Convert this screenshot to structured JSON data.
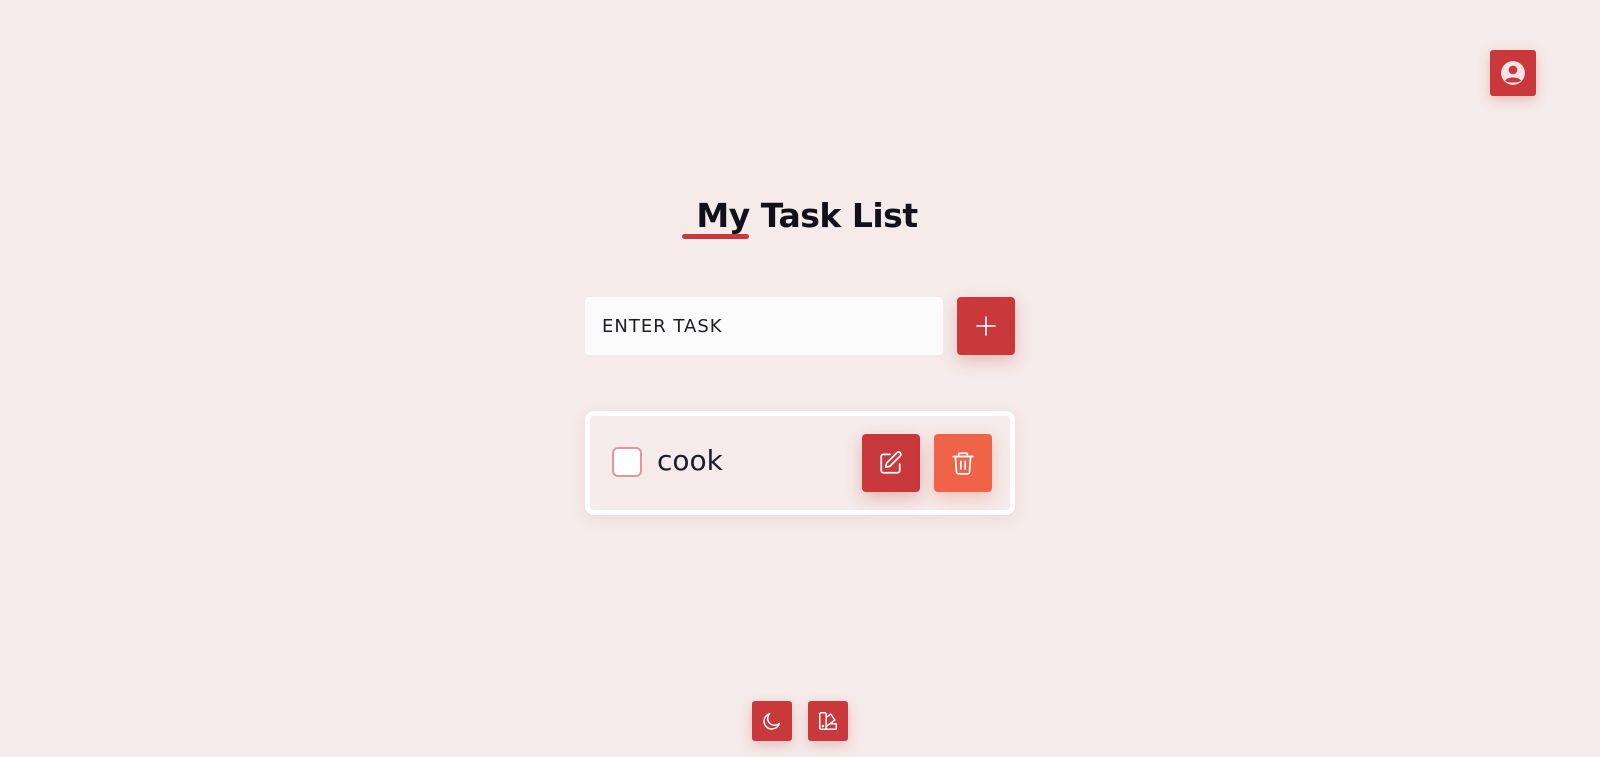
{
  "header": {
    "title": "My Task List"
  },
  "profile": {
    "icon": "user-circle-icon"
  },
  "task_form": {
    "input_placeholder": "ENTER TASK",
    "input_value": "",
    "add_icon": "plus-icon"
  },
  "tasks": [
    {
      "text": "cook",
      "completed": false,
      "edit_icon": "pencil-square-icon",
      "delete_icon": "trash-icon"
    }
  ],
  "footer": {
    "theme_icon": "moon-icon",
    "palette_icon": "swatch-icon"
  },
  "colors": {
    "background": "#f5ebea",
    "accent": "#c9383b",
    "danger": "#ef6448",
    "text": "#12111a"
  }
}
